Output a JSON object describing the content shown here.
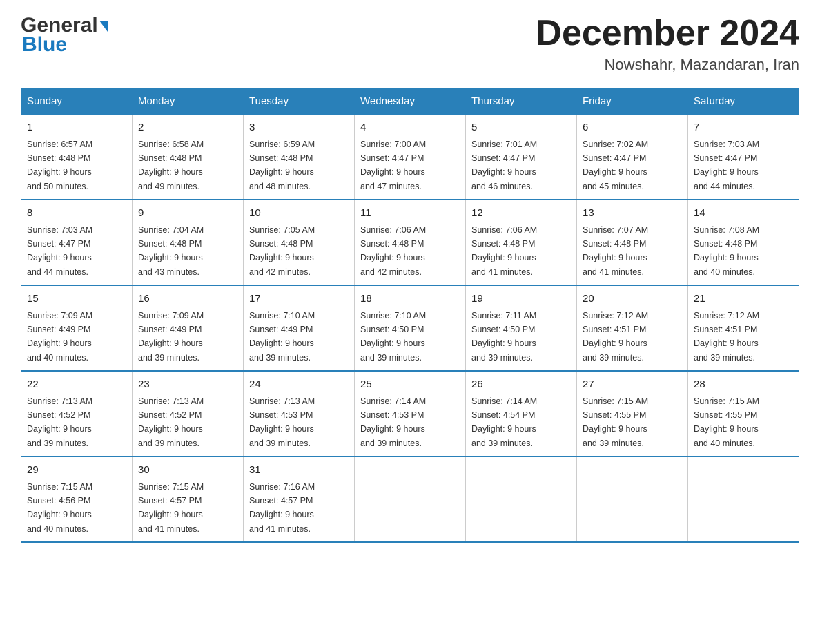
{
  "header": {
    "logo_general": "General",
    "logo_blue": "Blue",
    "title": "December 2024",
    "subtitle": "Nowshahr, Mazandaran, Iran"
  },
  "columns": [
    "Sunday",
    "Monday",
    "Tuesday",
    "Wednesday",
    "Thursday",
    "Friday",
    "Saturday"
  ],
  "weeks": [
    [
      {
        "day": "1",
        "sunrise": "6:57 AM",
        "sunset": "4:48 PM",
        "daylight": "9 hours and 50 minutes."
      },
      {
        "day": "2",
        "sunrise": "6:58 AM",
        "sunset": "4:48 PM",
        "daylight": "9 hours and 49 minutes."
      },
      {
        "day": "3",
        "sunrise": "6:59 AM",
        "sunset": "4:48 PM",
        "daylight": "9 hours and 48 minutes."
      },
      {
        "day": "4",
        "sunrise": "7:00 AM",
        "sunset": "4:47 PM",
        "daylight": "9 hours and 47 minutes."
      },
      {
        "day": "5",
        "sunrise": "7:01 AM",
        "sunset": "4:47 PM",
        "daylight": "9 hours and 46 minutes."
      },
      {
        "day": "6",
        "sunrise": "7:02 AM",
        "sunset": "4:47 PM",
        "daylight": "9 hours and 45 minutes."
      },
      {
        "day": "7",
        "sunrise": "7:03 AM",
        "sunset": "4:47 PM",
        "daylight": "9 hours and 44 minutes."
      }
    ],
    [
      {
        "day": "8",
        "sunrise": "7:03 AM",
        "sunset": "4:47 PM",
        "daylight": "9 hours and 44 minutes."
      },
      {
        "day": "9",
        "sunrise": "7:04 AM",
        "sunset": "4:48 PM",
        "daylight": "9 hours and 43 minutes."
      },
      {
        "day": "10",
        "sunrise": "7:05 AM",
        "sunset": "4:48 PM",
        "daylight": "9 hours and 42 minutes."
      },
      {
        "day": "11",
        "sunrise": "7:06 AM",
        "sunset": "4:48 PM",
        "daylight": "9 hours and 42 minutes."
      },
      {
        "day": "12",
        "sunrise": "7:06 AM",
        "sunset": "4:48 PM",
        "daylight": "9 hours and 41 minutes."
      },
      {
        "day": "13",
        "sunrise": "7:07 AM",
        "sunset": "4:48 PM",
        "daylight": "9 hours and 41 minutes."
      },
      {
        "day": "14",
        "sunrise": "7:08 AM",
        "sunset": "4:48 PM",
        "daylight": "9 hours and 40 minutes."
      }
    ],
    [
      {
        "day": "15",
        "sunrise": "7:09 AM",
        "sunset": "4:49 PM",
        "daylight": "9 hours and 40 minutes."
      },
      {
        "day": "16",
        "sunrise": "7:09 AM",
        "sunset": "4:49 PM",
        "daylight": "9 hours and 39 minutes."
      },
      {
        "day": "17",
        "sunrise": "7:10 AM",
        "sunset": "4:49 PM",
        "daylight": "9 hours and 39 minutes."
      },
      {
        "day": "18",
        "sunrise": "7:10 AM",
        "sunset": "4:50 PM",
        "daylight": "9 hours and 39 minutes."
      },
      {
        "day": "19",
        "sunrise": "7:11 AM",
        "sunset": "4:50 PM",
        "daylight": "9 hours and 39 minutes."
      },
      {
        "day": "20",
        "sunrise": "7:12 AM",
        "sunset": "4:51 PM",
        "daylight": "9 hours and 39 minutes."
      },
      {
        "day": "21",
        "sunrise": "7:12 AM",
        "sunset": "4:51 PM",
        "daylight": "9 hours and 39 minutes."
      }
    ],
    [
      {
        "day": "22",
        "sunrise": "7:13 AM",
        "sunset": "4:52 PM",
        "daylight": "9 hours and 39 minutes."
      },
      {
        "day": "23",
        "sunrise": "7:13 AM",
        "sunset": "4:52 PM",
        "daylight": "9 hours and 39 minutes."
      },
      {
        "day": "24",
        "sunrise": "7:13 AM",
        "sunset": "4:53 PM",
        "daylight": "9 hours and 39 minutes."
      },
      {
        "day": "25",
        "sunrise": "7:14 AM",
        "sunset": "4:53 PM",
        "daylight": "9 hours and 39 minutes."
      },
      {
        "day": "26",
        "sunrise": "7:14 AM",
        "sunset": "4:54 PM",
        "daylight": "9 hours and 39 minutes."
      },
      {
        "day": "27",
        "sunrise": "7:15 AM",
        "sunset": "4:55 PM",
        "daylight": "9 hours and 39 minutes."
      },
      {
        "day": "28",
        "sunrise": "7:15 AM",
        "sunset": "4:55 PM",
        "daylight": "9 hours and 40 minutes."
      }
    ],
    [
      {
        "day": "29",
        "sunrise": "7:15 AM",
        "sunset": "4:56 PM",
        "daylight": "9 hours and 40 minutes."
      },
      {
        "day": "30",
        "sunrise": "7:15 AM",
        "sunset": "4:57 PM",
        "daylight": "9 hours and 41 minutes."
      },
      {
        "day": "31",
        "sunrise": "7:16 AM",
        "sunset": "4:57 PM",
        "daylight": "9 hours and 41 minutes."
      },
      null,
      null,
      null,
      null
    ]
  ],
  "labels": {
    "sunrise": "Sunrise:",
    "sunset": "Sunset:",
    "daylight": "Daylight:"
  }
}
